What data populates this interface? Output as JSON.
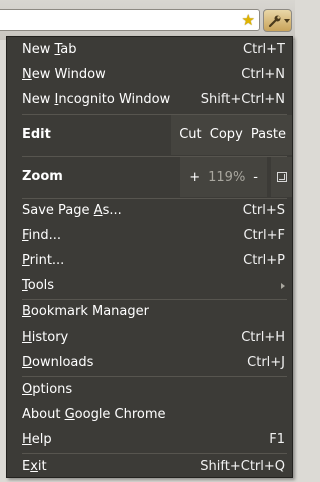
{
  "browser": {
    "star_glyph": "★",
    "wrench_icon": "wrench-icon"
  },
  "menu": {
    "group1": [
      {
        "pre": "New ",
        "acc": "T",
        "post": "ab",
        "shortcut": "Ctrl+T"
      },
      {
        "pre": "",
        "acc": "N",
        "post": "ew Window",
        "shortcut": "Ctrl+N"
      },
      {
        "pre": "New ",
        "acc": "I",
        "post": "ncognito Window",
        "shortcut": "Shift+Ctrl+N"
      }
    ],
    "edit": {
      "label": "Edit",
      "cut": "Cut",
      "copy": "Copy",
      "paste": "Paste"
    },
    "zoom": {
      "label": "Zoom",
      "plus": "+",
      "value": "119%",
      "minus": "-"
    },
    "group2": [
      {
        "pre": "Save Page ",
        "acc": "A",
        "post": "s...",
        "shortcut": "Ctrl+S"
      },
      {
        "pre": "",
        "acc": "F",
        "post": "ind...",
        "shortcut": "Ctrl+F"
      },
      {
        "pre": "",
        "acc": "P",
        "post": "rint...",
        "shortcut": "Ctrl+P"
      },
      {
        "pre": "",
        "acc": "T",
        "post": "ools",
        "shortcut": ""
      }
    ],
    "group3": [
      {
        "pre": "",
        "acc": "B",
        "post": "ookmark Manager",
        "shortcut": ""
      },
      {
        "pre": "",
        "acc": "H",
        "post": "istory",
        "shortcut": "Ctrl+H"
      },
      {
        "pre": "",
        "acc": "D",
        "post": "ownloads",
        "shortcut": "Ctrl+J"
      }
    ],
    "group4": [
      {
        "pre": "",
        "acc": "O",
        "post": "ptions",
        "shortcut": ""
      },
      {
        "pre": "About ",
        "acc": "G",
        "post": "oogle Chrome",
        "shortcut": ""
      },
      {
        "pre": "",
        "acc": "H",
        "post": "elp",
        "shortcut": "F1"
      }
    ],
    "exit": {
      "pre": "E",
      "acc": "x",
      "post": "it",
      "shortcut": "Shift+Ctrl+Q"
    }
  },
  "colors": {
    "menu_bg": "#3c3b37",
    "menu_text": "#ffffff",
    "disabled_text": "#a9a79f",
    "star": "#e0b400"
  }
}
